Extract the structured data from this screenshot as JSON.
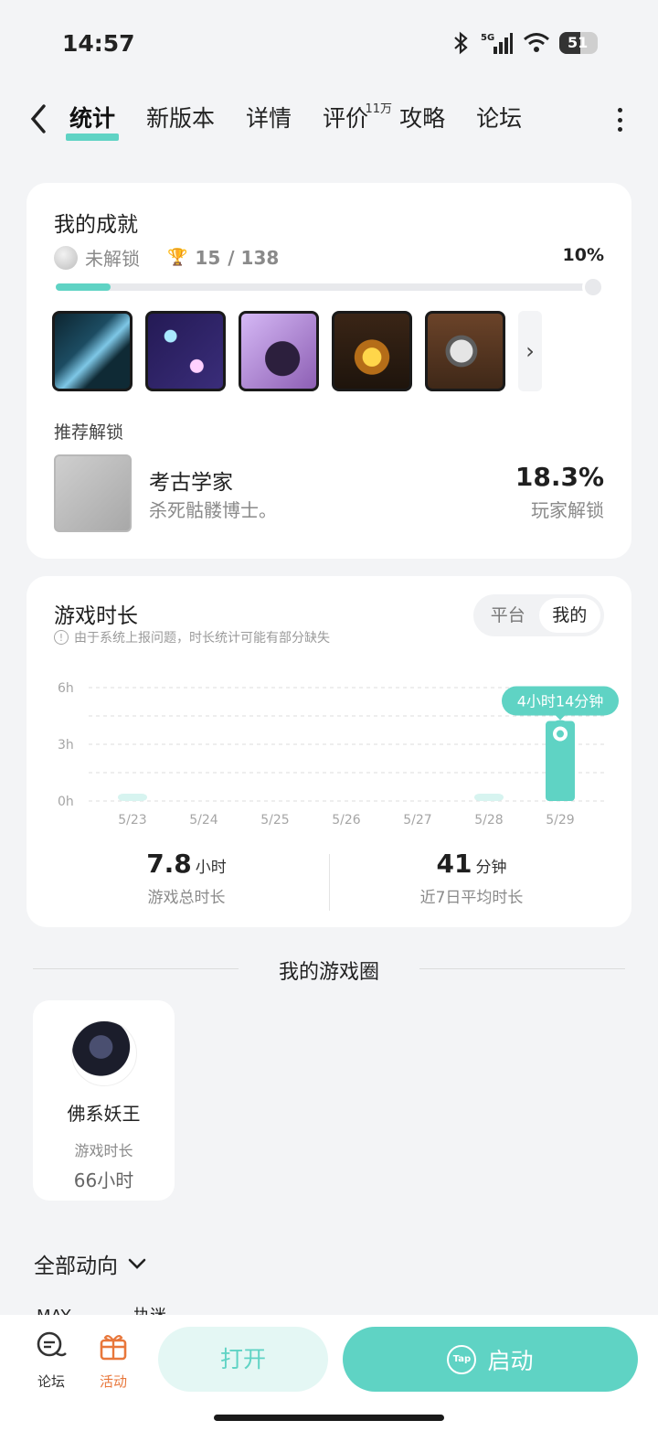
{
  "status": {
    "time": "14:57",
    "battery": "51",
    "network": "5G"
  },
  "nav": {
    "tabs": [
      {
        "label": "统计"
      },
      {
        "label": "新版本"
      },
      {
        "label": "详情"
      },
      {
        "label": "评价",
        "badge": "11万"
      },
      {
        "label": "攻略"
      },
      {
        "label": "论坛"
      }
    ]
  },
  "achievements": {
    "title": "我的成就",
    "locked_label": "未解锁",
    "unlocked": "15",
    "total": "/ 138",
    "percent_text": "10%",
    "progress": 0.1,
    "recommend_title": "推荐解锁",
    "recommend": {
      "name": "考古学家",
      "desc": "杀死骷髅博士。",
      "percent": "18.3%",
      "percent_label": "玩家解锁"
    }
  },
  "playtime": {
    "title": "游戏时长",
    "notice": "由于系统上报问题，时长统计可能有部分缺失",
    "toggle": [
      "平台",
      "我的"
    ],
    "total_value": "7.8",
    "total_unit": "小时",
    "total_label": "游戏总时长",
    "avg_value": "41",
    "avg_unit": "分钟",
    "avg_label": "近7日平均时长"
  },
  "chart_data": {
    "type": "bar",
    "categories": [
      "5/23",
      "5/24",
      "5/25",
      "5/26",
      "5/27",
      "5/28",
      "5/29"
    ],
    "values": [
      0.05,
      0,
      0,
      0,
      0,
      0.05,
      4.233
    ],
    "y_ticks": [
      "0h",
      "3h",
      "6h"
    ],
    "ylim": [
      0,
      6
    ],
    "highlight_label": "4小时14分钟",
    "colors": {
      "bar": "#5fd3c4",
      "bar_light": "#d7f4f0"
    }
  },
  "circle": {
    "title": "我的游戏圈",
    "friend": {
      "name": "佛系妖王",
      "label": "游戏时长",
      "hours": "66小时"
    }
  },
  "feed": {
    "filter": "全部动向",
    "peek_month": "MAY",
    "peek_name": "执迷"
  },
  "bottom": {
    "forum": "论坛",
    "activity": "活动",
    "open": "打开",
    "start": "启动",
    "tap": "Tap"
  }
}
